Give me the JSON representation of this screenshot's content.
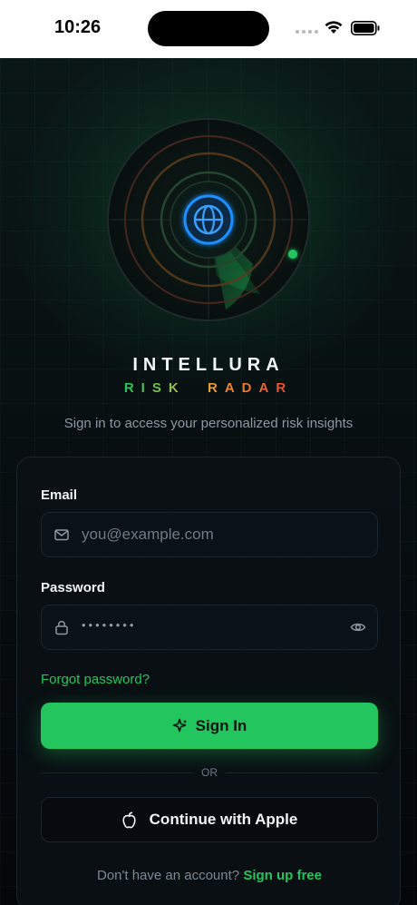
{
  "status_bar": {
    "time": "10:26"
  },
  "brand": {
    "title": "INTELLURA",
    "subtitle_word1": "RISK",
    "subtitle_word2": "RADAR"
  },
  "tagline": "Sign in to access your personalized risk insights",
  "form": {
    "email_label": "Email",
    "email_placeholder": "you@example.com",
    "email_value": "",
    "password_label": "Password",
    "password_masked": "••••••••",
    "forgot_label": "Forgot password?",
    "signin_label": "Sign In",
    "divider_text": "OR",
    "apple_label": "Continue with Apple",
    "signup_prompt": "Don't have an account?",
    "signup_link": "Sign up free"
  },
  "icons": {
    "logo": "globe-icon",
    "email": "mail-icon",
    "password": "lock-icon",
    "reveal": "eye-icon",
    "signin": "sparkle-icon",
    "apple": "apple-icon"
  },
  "colors": {
    "accent": "#22c55e",
    "background": "#05090b",
    "card": "#0a1014",
    "radar_blip": "#22c55e",
    "globe": "#1e90ff",
    "risk_orange": "#e45a32"
  }
}
